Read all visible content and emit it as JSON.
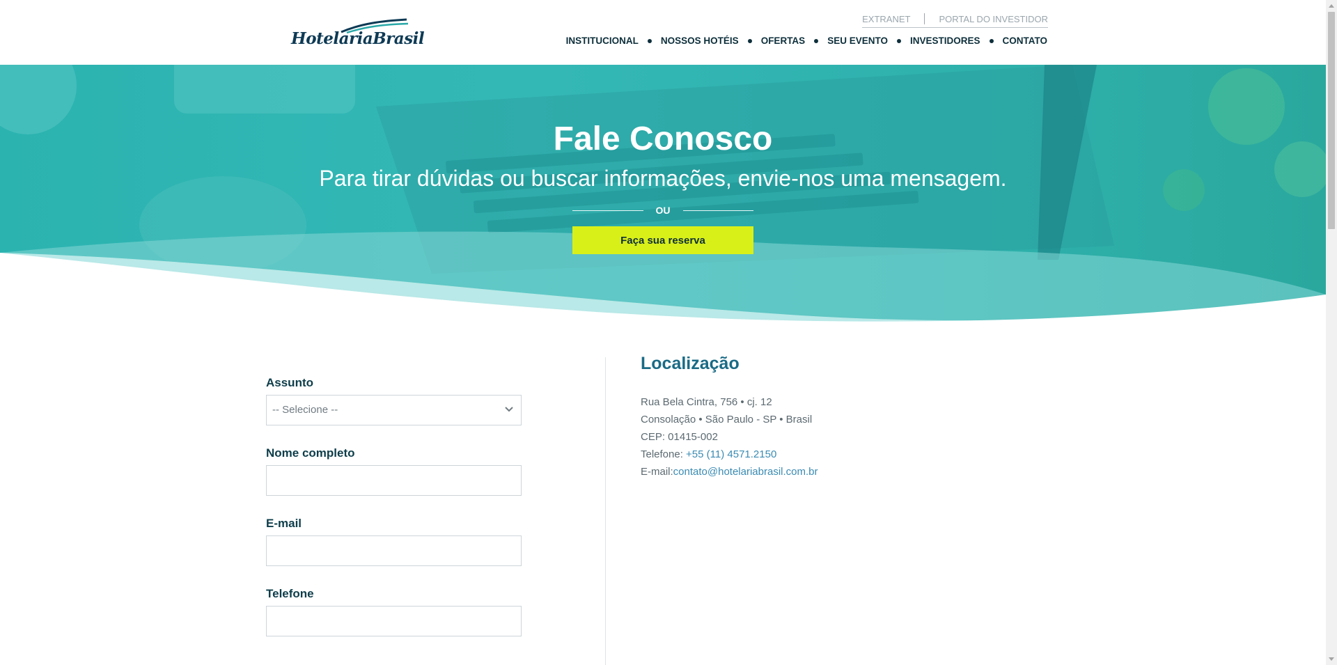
{
  "header": {
    "logo_text": "HotelariaBrasil",
    "top_links": [
      "EXTRANET",
      "PORTAL DO INVESTIDOR"
    ],
    "nav": [
      "INSTITUCIONAL",
      "NOSSOS HOTÉIS",
      "OFERTAS",
      "SEU EVENTO",
      "INVESTIDORES",
      "CONTATO"
    ]
  },
  "hero": {
    "title": "Fale Conosco",
    "subtitle": "Para tirar dúvidas ou buscar informações, envie-nos uma mensagem.",
    "or_label": "OU",
    "cta_label": "Faça sua reserva"
  },
  "form": {
    "subject_label": "Assunto",
    "subject_value": "-- Selecione --",
    "name_label": "Nome completo",
    "name_value": "",
    "email_label": "E-mail",
    "email_value": "",
    "phone_label": "Telefone",
    "phone_value": ""
  },
  "location": {
    "title": "Localização",
    "address_line1": "Rua Bela Cintra, 756 • cj. 12",
    "address_line2": "Consolação • São Paulo - SP • Brasil",
    "cep": "CEP: 01415-002",
    "phone_label": "Telefone: ",
    "phone_value": "+55 (11) 4571.2150",
    "email_label": "E-mail:",
    "email_value": "contato@hotelariabrasil.com.br"
  },
  "colors": {
    "brand_dark": "#0d3a55",
    "hero_teal": "#2fb3b0",
    "cta_yellow": "#d9f018",
    "heading_blue": "#1a6b85",
    "link_blue": "#3a8bb3"
  },
  "icons": {
    "select_arrow": "chevron-down-icon",
    "logo_mark": "wave-logo-icon",
    "scroll_up": "arrow-up-icon",
    "scroll_down": "arrow-down-icon"
  }
}
